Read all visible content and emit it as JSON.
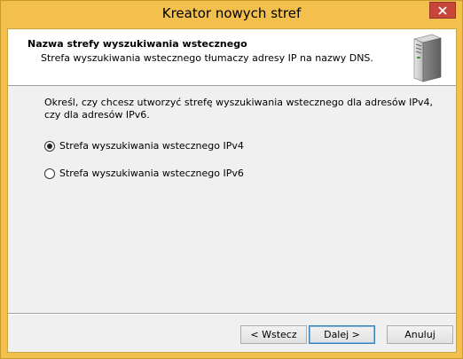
{
  "window": {
    "title": "Kreator nowych stref"
  },
  "header": {
    "title": "Nazwa strefy wyszukiwania wstecznego",
    "subtitle": "Strefa wyszukiwania wstecznego tłumaczy adresy IP na nazwy DNS.",
    "icon": "server-icon"
  },
  "content": {
    "description": "Określ, czy chcesz utworzyć strefę wyszukiwania wstecznego dla adresów IPv4, czy dla adresów IPv6.",
    "options": [
      {
        "label": "Strefa wyszukiwania wstecznego IPv4",
        "selected": true
      },
      {
        "label": "Strefa wyszukiwania wstecznego IPv6",
        "selected": false
      }
    ]
  },
  "buttons": {
    "back": "< Wstecz",
    "next": "Dalej >",
    "cancel": "Anuluj"
  },
  "colors": {
    "frame": "#f4c04d",
    "close_button": "#c7463a",
    "default_button_border": "#3c7fb1"
  }
}
